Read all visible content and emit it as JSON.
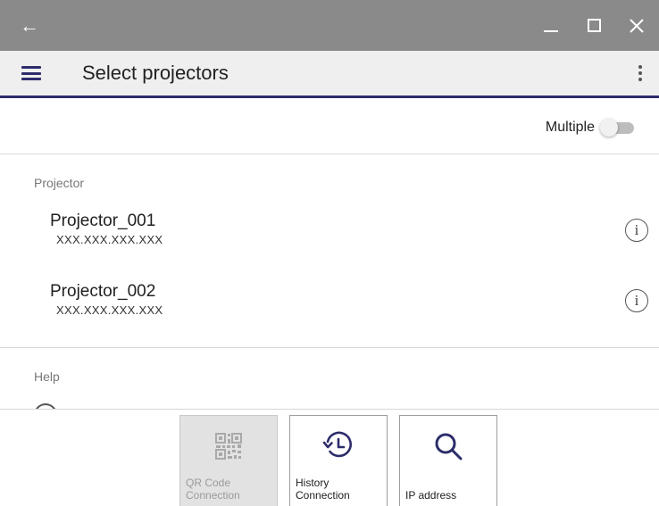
{
  "window": {
    "back_icon": "arrow-left-icon",
    "controls": [
      "minimize-icon",
      "maximize-icon",
      "close-icon"
    ]
  },
  "appbar": {
    "title": "Select projectors",
    "menu_icon": "hamburger-icon",
    "overflow_icon": "kebab-icon"
  },
  "multiple": {
    "label": "Multiple",
    "enabled": false
  },
  "projector_section": {
    "label": "Projector",
    "items": [
      {
        "name": "Projector_001",
        "ip": "XXX.XXX.XXX.XXX",
        "info_icon": "info-icon"
      },
      {
        "name": "Projector_002",
        "ip": "XXX.XXX.XXX.XXX",
        "info_icon": "info-icon"
      }
    ]
  },
  "help_section": {
    "label": "Help"
  },
  "bottom_actions": [
    {
      "line1": "QR Code",
      "line2": "Connection",
      "icon": "qr-code-icon",
      "disabled": true
    },
    {
      "line1": "History",
      "line2": "Connection",
      "icon": "history-icon",
      "disabled": false
    },
    {
      "line1": "IP address",
      "line2": "",
      "icon": "search-icon",
      "disabled": false
    }
  ],
  "colors": {
    "titlebar": "#8a8a8a",
    "appbar": "#efefef",
    "accent": "#2d2d6b",
    "divider": "#d6d6d6"
  }
}
